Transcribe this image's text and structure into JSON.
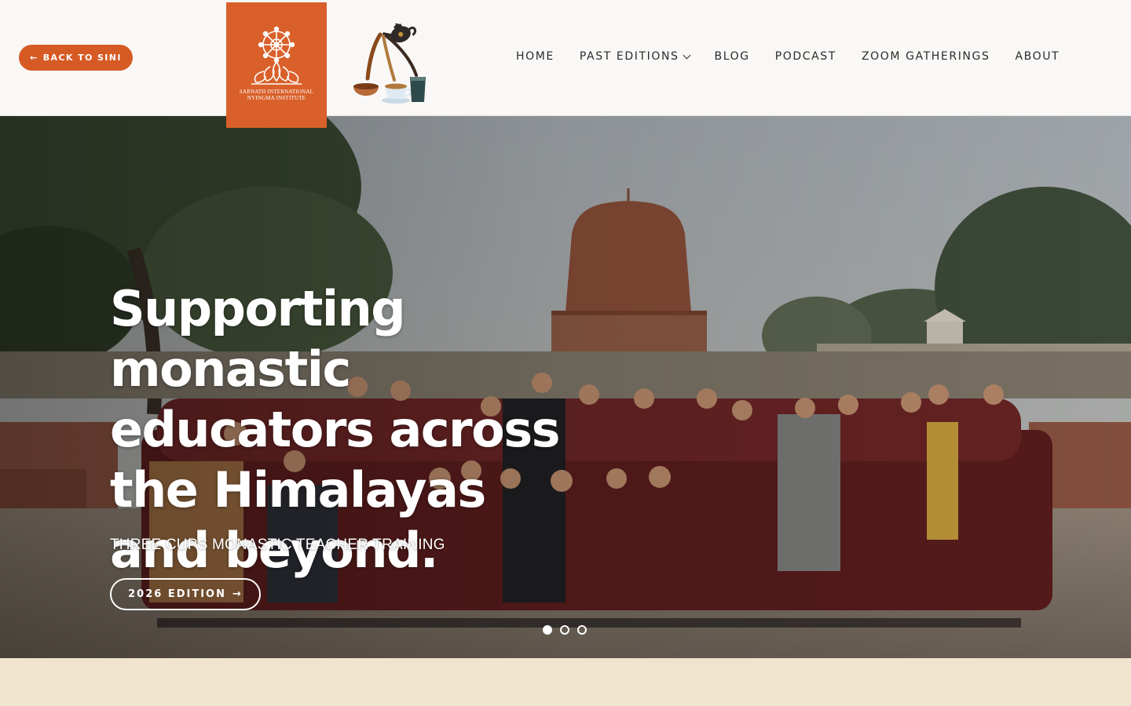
{
  "header": {
    "back_label": "BACK TO SINI",
    "back_icon": "arrow-left-icon",
    "logo_text_line1": "SARNATH INTERNATIONAL",
    "logo_text_line2": "NYINGMA INSTITUTE",
    "nav": [
      {
        "label": "HOME"
      },
      {
        "label": "PAST EDITIONS",
        "has_dropdown": true
      },
      {
        "label": "BLOG"
      },
      {
        "label": "PODCAST"
      },
      {
        "label": "ZOOM GATHERINGS"
      },
      {
        "label": "ABOUT"
      }
    ]
  },
  "hero": {
    "title": "Supporting monastic educators across the Himalayas and beyond.",
    "subtitle": "THREE CUPS MONASTIC TEACHER TRAINING",
    "cta_label": "2026 EDITION",
    "cta_icon": "arrow-right-icon",
    "slides_total": 3,
    "active_slide": 1
  },
  "colors": {
    "accent": "#d65a24",
    "logo_bg": "#d9602a",
    "header_bg": "#f9f8f6",
    "footer_band": "#f1e4cf"
  }
}
